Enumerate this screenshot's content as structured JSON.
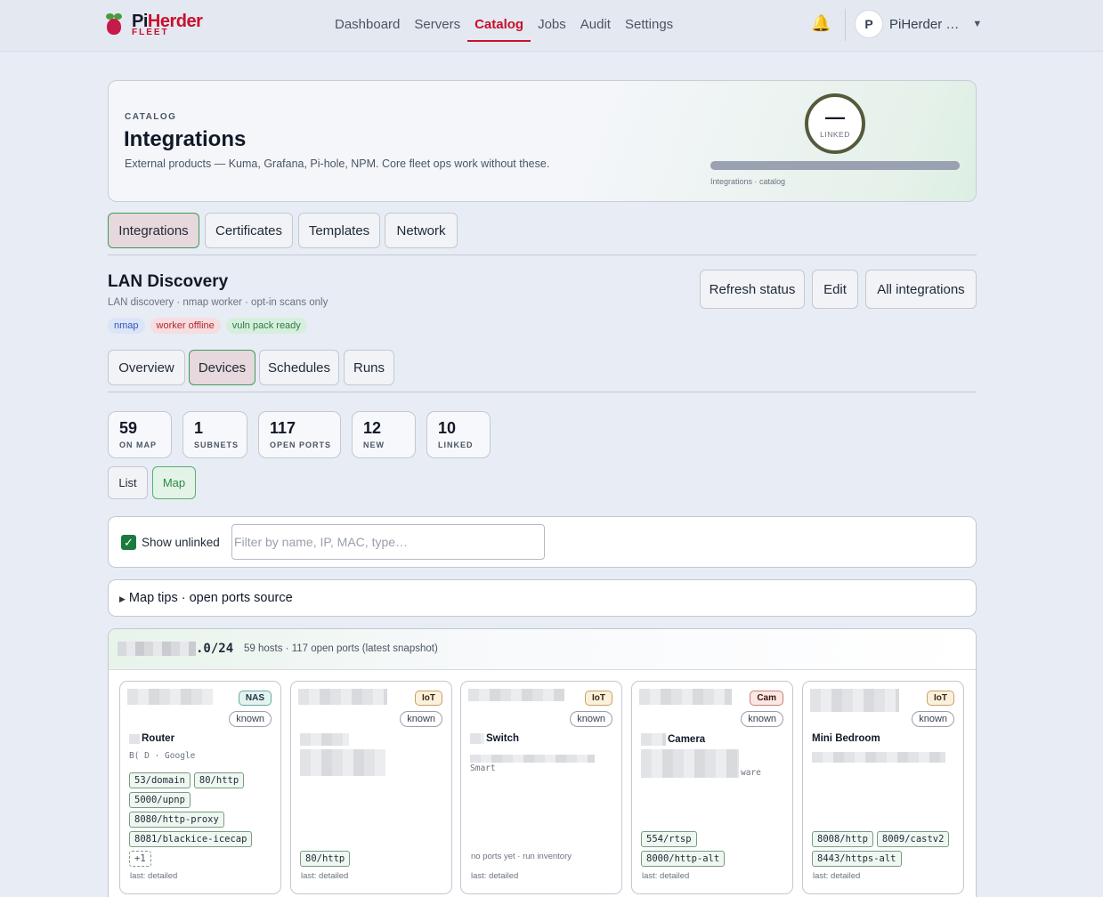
{
  "brand": {
    "name_a": "Pi",
    "name_b": "Herder",
    "sub": "FLEET"
  },
  "nav": [
    "Dashboard",
    "Servers",
    "Catalog",
    "Jobs",
    "Audit",
    "Settings"
  ],
  "nav_active": "Catalog",
  "user": {
    "initial": "P",
    "name": "PiHerder …"
  },
  "hero": {
    "eyebrow": "CATALOG",
    "title": "Integrations",
    "subtitle": "External products — Kuma, Grafana, Pi-hole, NPM. Core fleet ops work without these.",
    "ring_value": "—",
    "ring_label": "LINKED",
    "footer": "Integrations · catalog"
  },
  "catalog_tabs": [
    "Integrations",
    "Certificates",
    "Templates",
    "Network"
  ],
  "integration": {
    "title": "LAN Discovery",
    "subtitle": "LAN discovery · nmap worker · opt-in scans only",
    "chips": [
      {
        "label": "nmap",
        "color": "blue"
      },
      {
        "label": "worker offline",
        "color": "red"
      },
      {
        "label": "vuln pack ready",
        "color": "green"
      }
    ],
    "actions": [
      "Refresh status",
      "Edit",
      "All integrations"
    ]
  },
  "subtabs": [
    "Overview",
    "Devices",
    "Schedules",
    "Runs"
  ],
  "stats": [
    {
      "value": "59",
      "label": "ON MAP"
    },
    {
      "value": "1",
      "label": "SUBNETS"
    },
    {
      "value": "117",
      "label": "OPEN PORTS"
    },
    {
      "value": "12",
      "label": "NEW"
    },
    {
      "value": "10",
      "label": "LINKED"
    }
  ],
  "view_toggle": [
    "List",
    "Map"
  ],
  "filter": {
    "checkbox_label": "Show unlinked",
    "placeholder": "Filter by name, IP, MAC, type…"
  },
  "tips": "Map tips · open ports source",
  "subnet": {
    "cidr_suffix": ".0/24",
    "meta": "59 hosts · 117 open ports (latest snapshot)"
  },
  "devices": [
    {
      "type": "NAS",
      "status": "known",
      "name": "Router",
      "vendor": "B(            D · Google",
      "ports": [
        "53/domain",
        "80/http",
        "5000/upnp",
        "8080/http-proxy",
        "8081/blackice-icecap"
      ],
      "more": "+1",
      "noports": "",
      "last": "last: detailed"
    },
    {
      "type": "IoT",
      "status": "known",
      "name": "",
      "vendor": "",
      "ports": [
        "80/http"
      ],
      "more": "",
      "noports": "",
      "last": "last: detailed"
    },
    {
      "type": "IoT",
      "status": "known",
      "name": "Switch",
      "vendor": "Smart",
      "ports": [],
      "more": "",
      "noports": "no ports yet · run inventory",
      "last": "last: detailed"
    },
    {
      "type": "Cam",
      "status": "known",
      "name": "Camera",
      "vendor": "ware",
      "ports": [
        "554/rtsp",
        "8000/http-alt"
      ],
      "more": "",
      "noports": "",
      "last": "last: detailed"
    },
    {
      "type": "IoT",
      "status": "known",
      "name": "Mini Bedroom",
      "vendor": "",
      "ports": [
        "8008/http",
        "8009/castv2",
        "8443/https-alt"
      ],
      "more": "",
      "noports": "",
      "last": "last: detailed"
    }
  ]
}
